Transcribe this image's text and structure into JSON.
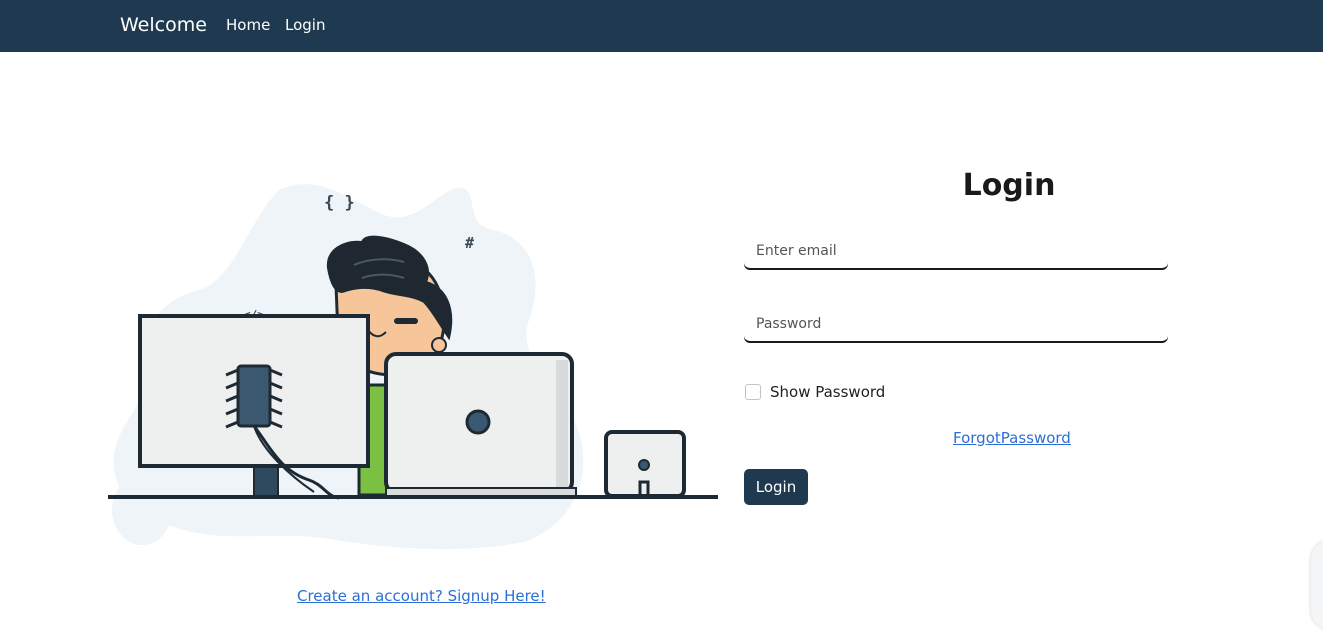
{
  "navbar": {
    "brand": "Welcome",
    "links": [
      "Home",
      "Login"
    ]
  },
  "illustration": {
    "symbols": [
      "{ }",
      "#",
      "</>"
    ]
  },
  "signup": {
    "link_text": "Create an account? Signup Here!"
  },
  "login_form": {
    "title": "Login",
    "email_placeholder": "Enter email",
    "password_placeholder": "Password",
    "show_password_label": "Show Password",
    "show_password_checked": false,
    "forgot_password_label": "ForgotPassword",
    "submit_label": "Login"
  },
  "colors": {
    "navbar": "#1f3a50",
    "link": "#2b6fd6",
    "blob": "#eef4f8",
    "button": "#1f3a50"
  }
}
